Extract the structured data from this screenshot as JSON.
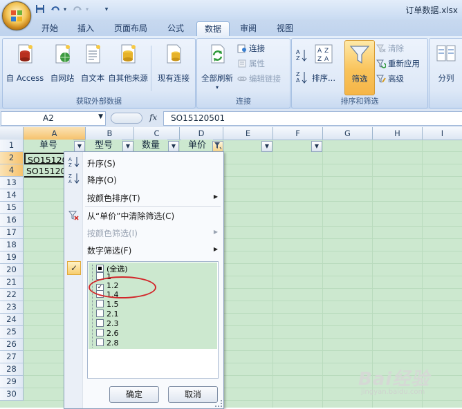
{
  "window": {
    "title": "订单数据.xlsx",
    "quick_access": [
      "save-icon",
      "undo-icon",
      "redo-icon",
      "customize-icon"
    ]
  },
  "tabs": [
    {
      "label": "开始"
    },
    {
      "label": "插入"
    },
    {
      "label": "页面布局"
    },
    {
      "label": "公式"
    },
    {
      "label": "数据",
      "active": true
    },
    {
      "label": "审阅"
    },
    {
      "label": "视图"
    }
  ],
  "ribbon": {
    "external": {
      "label": "获取外部数据",
      "buttons": [
        "自 Access",
        "自网站",
        "自文本",
        "自其他来源",
        "现有连接"
      ]
    },
    "connections": {
      "label": "连接",
      "refresh_all": "全部刷新",
      "connections": "连接",
      "properties": "属性",
      "edit_links": "编辑链接"
    },
    "sort_filter": {
      "label": "排序和筛选",
      "sort": "排序...",
      "filter": "筛选",
      "clear": "清除",
      "reapply": "重新应用",
      "advanced": "高级"
    },
    "tools": {
      "split": "分列"
    }
  },
  "formula_bar": {
    "name_box": "A2",
    "fx": "fx",
    "formula": "SO15120501"
  },
  "grid": {
    "columns": [
      "A",
      "B",
      "C",
      "D",
      "E",
      "F",
      "G",
      "H",
      "I"
    ],
    "rows": [
      "1",
      "2",
      "4",
      "13",
      "14",
      "15",
      "16",
      "17",
      "18",
      "19",
      "20",
      "21",
      "22",
      "23",
      "24",
      "25",
      "26",
      "27",
      "28",
      "29",
      "30"
    ],
    "header_cells": [
      "单号",
      "型号",
      "数量",
      "单价"
    ],
    "cells": {
      "a2": "SO15120",
      "a4": "SO15120"
    }
  },
  "filter_menu": {
    "sort_asc": "升序(S)",
    "sort_desc": "降序(O)",
    "sort_by_color": "按颜色排序(T)",
    "clear_filter": "从“单价”中清除筛选(C)",
    "filter_by_color": "按颜色筛选(I)",
    "number_filters": "数字筛选(F)",
    "items": [
      {
        "label": "(全选)",
        "state": "partial"
      },
      {
        "label": "1",
        "state": "unchecked"
      },
      {
        "label": "1.2",
        "state": "checked"
      },
      {
        "label": "1.4",
        "state": "unchecked"
      },
      {
        "label": "1.5",
        "state": "unchecked"
      },
      {
        "label": "2.1",
        "state": "unchecked"
      },
      {
        "label": "2.3",
        "state": "unchecked"
      },
      {
        "label": "2.6",
        "state": "unchecked"
      },
      {
        "label": "2.8",
        "state": "unchecked"
      }
    ],
    "ok": "确定",
    "cancel": "取消"
  },
  "watermark": {
    "brand": "Bai经验",
    "url": "jingyan.baidu.com"
  },
  "colors": {
    "sheet_background": "#cce8cf",
    "ribbon": "#dbe7f6",
    "highlight": "#d2262a",
    "filter_button": "#f9c35a"
  }
}
